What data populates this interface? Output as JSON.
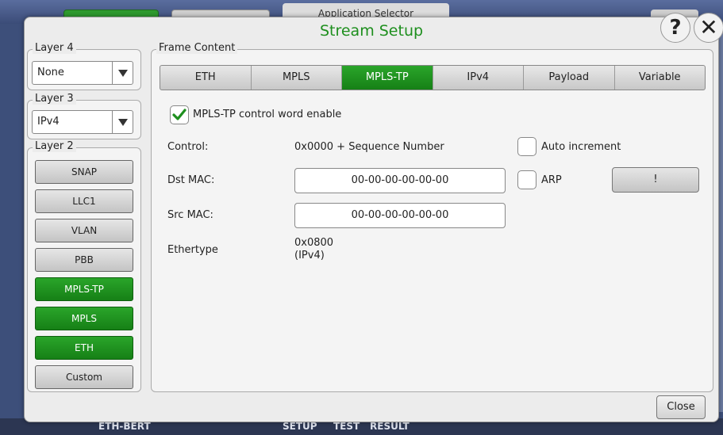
{
  "background": {
    "app_selector": "Application Selector",
    "bottom_app": "ETH-BERT",
    "bottom_tabs": [
      "SETUP",
      "TEST",
      "RESULT"
    ]
  },
  "dialog": {
    "title": "Stream Setup",
    "help": "?",
    "close_x": "✕",
    "close_button": "Close"
  },
  "layer4": {
    "legend": "Layer 4",
    "value": "None"
  },
  "layer3": {
    "legend": "Layer 3",
    "value": "IPv4"
  },
  "layer2": {
    "legend": "Layer 2",
    "buttons": [
      {
        "label": "SNAP",
        "active": false
      },
      {
        "label": "LLC1",
        "active": false
      },
      {
        "label": "VLAN",
        "active": false
      },
      {
        "label": "PBB",
        "active": false
      },
      {
        "label": "MPLS-TP",
        "active": true
      },
      {
        "label": "MPLS",
        "active": true
      },
      {
        "label": "ETH",
        "active": true
      },
      {
        "label": "Custom",
        "active": false
      }
    ]
  },
  "frame": {
    "legend": "Frame Content",
    "tabs": [
      "ETH",
      "MPLS",
      "MPLS-TP",
      "IPv4",
      "Payload",
      "Variable"
    ],
    "active_tab": "MPLS-TP",
    "control_word_label": "MPLS-TP control word enable",
    "control_word_checked": true,
    "control_label": "Control:",
    "control_value": "0x0000 + Sequence Number",
    "auto_increment_label": "Auto increment",
    "dst_mac_label": "Dst MAC:",
    "dst_mac_value": "00-00-00-00-00-00",
    "arp_label": "ARP",
    "arp_button": "!",
    "src_mac_label": "Src MAC:",
    "src_mac_value": "00-00-00-00-00-00",
    "ethertype_label": "Ethertype",
    "ethertype_value": "0x0800",
    "ethertype_name": "(IPv4)"
  },
  "colors": {
    "accent_green": "#1e8f1e",
    "active_button": "#168016"
  }
}
